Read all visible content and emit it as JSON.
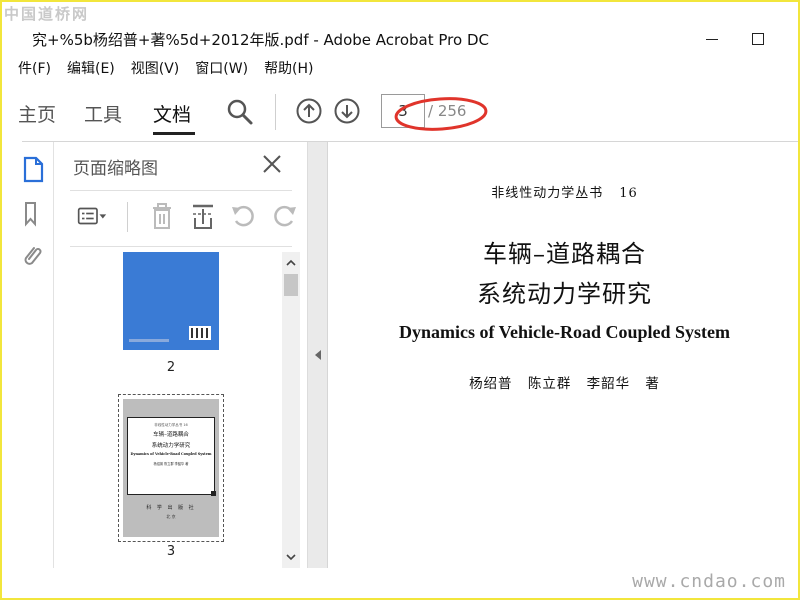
{
  "watermark": {
    "top": "中国道桥网",
    "bottom": "www.cndao.com"
  },
  "window": {
    "title": "究+%5b杨绍普+著%5d+2012年版.pdf - Adobe Acrobat Pro DC"
  },
  "menu": {
    "items": [
      {
        "label": "件(F)"
      },
      {
        "label": "编辑(E)"
      },
      {
        "label": "视图(V)"
      },
      {
        "label": "窗口(W)"
      },
      {
        "label": "帮助(H)"
      }
    ]
  },
  "toolbar": {
    "home_label": "主页",
    "tools_label": "工具",
    "document_label": "文档",
    "search_icon": "search-icon",
    "prev_icon": "arrow-up-circle-icon",
    "next_icon": "arrow-down-circle-icon",
    "current_page": "3",
    "total_pages": "/ 256"
  },
  "side_nav": {
    "icons": [
      "page-thumbnails-icon",
      "bookmark-icon",
      "attachment-icon"
    ]
  },
  "thumbnails_panel": {
    "title": "页面缩略图",
    "close_icon": "close-icon",
    "tool_icons": [
      "thumbnail-options-icon",
      "delete-page-icon",
      "extract-page-icon",
      "rotate-left-icon",
      "rotate-right-icon"
    ],
    "pages": [
      {
        "label": "2",
        "color": "#3a7bd5"
      },
      {
        "label": "3",
        "selected": true,
        "mini_series": "非线性动力学丛书 16",
        "mini_title_1": "车辆–道路耦合",
        "mini_title_2": "系统动力学研究",
        "mini_english": "Dynamics of Vehicle-Road Coupled System",
        "mini_authors": "杨绍普 陈立群 李韶华 著",
        "mini_publisher": "科 学 出 版 社",
        "mini_city": "北 京"
      }
    ]
  },
  "document_page": {
    "series": "非线性动力学丛书",
    "series_number": "16",
    "title_line1": "车辆–道路耦合",
    "title_line2": "系统动力学研究",
    "english_title": "Dynamics of Vehicle-Road Coupled System",
    "authors": "杨绍普 陈立群 李韶华 著"
  },
  "colors": {
    "frame": "#f2e63c",
    "highlight_ellipse": "#e0342b",
    "cover_blue": "#3a7bd5",
    "nav_accent": "#2a6fd8"
  }
}
